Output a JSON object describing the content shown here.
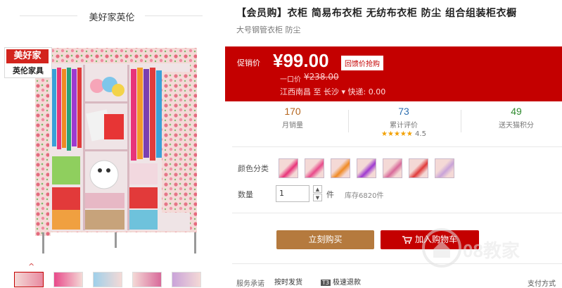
{
  "store": {
    "name": "美好家英伦"
  },
  "logo": {
    "line1": "美好家",
    "line2": "英伦家具"
  },
  "gallery": {
    "up_arrow": "^"
  },
  "product": {
    "title": "【会员购】衣柜 简易布衣柜 无纺布衣柜 防尘 组合组装柜衣橱",
    "subtitle": "大号钢管衣柜 防尘"
  },
  "price": {
    "label": "促销价",
    "value": "¥99.00",
    "badge": "回馈价抢购",
    "orig_label": "一口价",
    "orig_value": "¥238.00",
    "shipping": "江西南昌 至 长沙 ▾  快递: 0.00"
  },
  "stats": [
    {
      "value": "170",
      "label": "月销量",
      "color": "#b5651d"
    },
    {
      "value": "73",
      "label": "累计评价",
      "color": "#2e6fb0",
      "rating": "4.5",
      "stars": "★★★★★"
    },
    {
      "value": "49",
      "label": "送天猫积分",
      "color": "#2f8a2f"
    }
  ],
  "options": {
    "color_label": "颜色分类",
    "qty_label": "数量",
    "qty_value": "1",
    "qty_unit": "件",
    "stock": "库存6820件"
  },
  "buttons": {
    "buy": "立刻购买",
    "cart": "加入购物车"
  },
  "service": {
    "label": "服务承诺",
    "item1": "按时发货",
    "item2_tag": "T3",
    "item2": "极速退款",
    "pay": "支付方式"
  },
  "watermark": {
    "text": "08教家"
  },
  "colors": {
    "accent": "#c40000",
    "buy": "#b57a3e"
  }
}
